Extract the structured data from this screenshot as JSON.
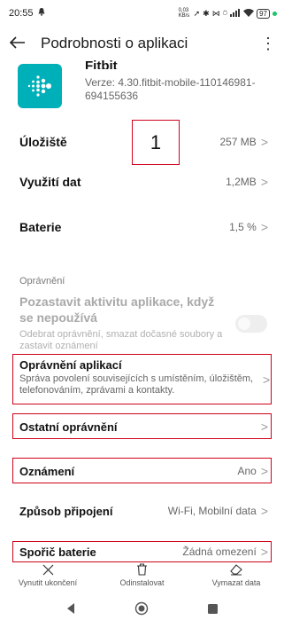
{
  "status_bar": {
    "time": "20:55",
    "speed": "0,03 KB/s",
    "battery": "97"
  },
  "appbar": {
    "title": "Podrobnosti o aplikaci"
  },
  "app": {
    "name": "Fitbit",
    "version": "Verze: 4.30.fitbit-mobile-110146981-694155636"
  },
  "annotation": {
    "number": "1"
  },
  "rows": {
    "storage": {
      "label": "Úložiště",
      "value": "257 MB"
    },
    "data_usage": {
      "label": "Využití dat",
      "value": "1,2MB"
    },
    "battery": {
      "label": "Baterie",
      "value": "1,5 %"
    }
  },
  "permissions_section": {
    "label": "Oprávnění",
    "pause_title": "Pozastavit aktivitu aplikace, když se nepoužívá",
    "pause_desc": "Odebrat oprávnění, smazat dočasné soubory a zastavit oznámení",
    "pause_enabled": false,
    "app_permissions_title": "Oprávnění aplikací",
    "app_permissions_desc": "Správa povolení souvisejících s umístěním, úložištěm, telefonováním, zprávami a kontakty.",
    "other_permissions": "Ostatní oprávnění",
    "notifications_label": "Oznámení",
    "notifications_value": "Ano",
    "connection_label": "Způsob připojení",
    "connection_value": "Wi-Fi, Mobilní data",
    "battery_saver_label": "Spořič baterie",
    "battery_saver_value": "Žádná omezení"
  },
  "bottom_actions": {
    "force_stop": "Vynutit ukončení",
    "uninstall": "Odinstalovat",
    "clear_data": "Vymazat data"
  },
  "colors": {
    "accent_red": "#d0021b",
    "fitbit_teal": "#00b0b9"
  }
}
